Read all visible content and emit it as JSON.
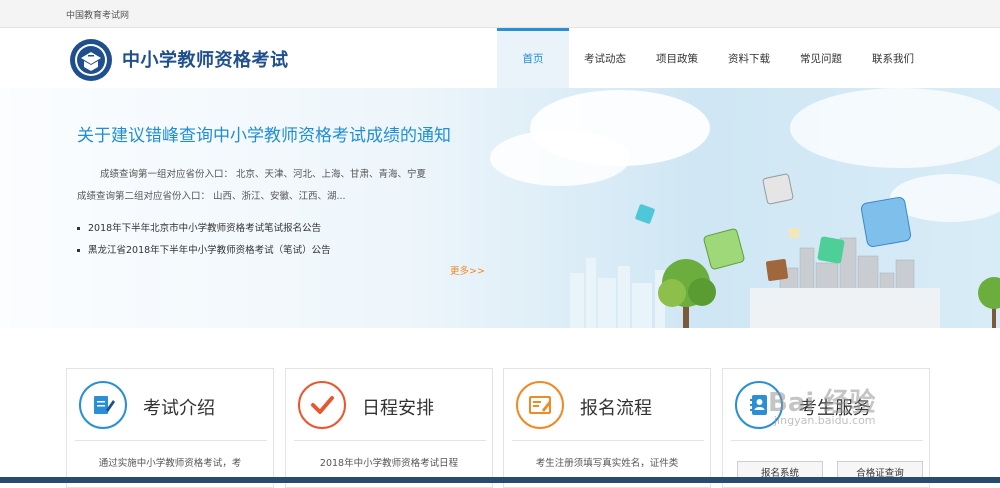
{
  "topbar": {
    "site_link": "中国教育考试网"
  },
  "header": {
    "title": "中小学教师资格考试",
    "nav": [
      {
        "label": "首页",
        "active": true
      },
      {
        "label": "考试动态"
      },
      {
        "label": "项目政策"
      },
      {
        "label": "资料下载"
      },
      {
        "label": "常见问题"
      },
      {
        "label": "联系我们"
      }
    ]
  },
  "banner": {
    "headline": "关于建议错峰查询中小学教师资格考试成绩的通知",
    "desc_line1": "成绩查询第一组对应省份入口： 北京、天津、河北、上海、甘肃、青海、宁夏",
    "desc_line2": "成绩查询第二组对应省份入口： 山西、浙江、安徽、江西、湖...",
    "news": [
      "2018年下半年北京市中小学教师资格考试笔试报名公告",
      "黑龙江省2018年下半年中小学教师资格考试（笔试）公告"
    ],
    "more": "更多>>"
  },
  "cards": [
    {
      "title": "考试介绍",
      "desc": "通过实施中小学教师资格考试，考",
      "icon": "document-edit-icon",
      "color": "#2a8fd3"
    },
    {
      "title": "日程安排",
      "desc": "2018年中小学教师资格考试日程",
      "icon": "checkmark-icon",
      "color": "#e8582f"
    },
    {
      "title": "报名流程",
      "desc": "考生注册须填写真实姓名，证件类",
      "icon": "form-pencil-icon",
      "color": "#f08a24"
    },
    {
      "title": "考生服务",
      "buttons": [
        "报名系统",
        "合格证查询"
      ],
      "icon": "contact-book-icon",
      "color": "#2a8fd3"
    }
  ],
  "watermark": {
    "brand": "Bai 经验",
    "url": "jingyan.baidu.com"
  }
}
